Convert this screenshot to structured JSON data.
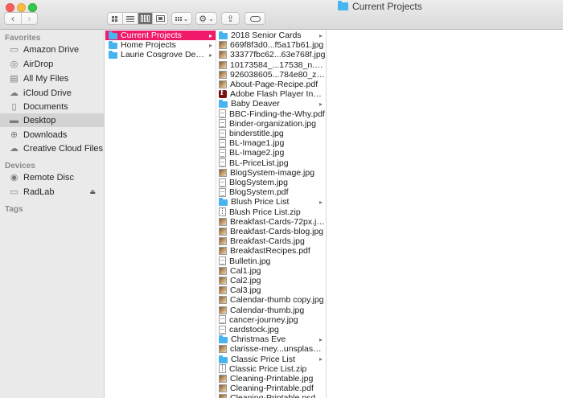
{
  "window": {
    "title": "Current Projects",
    "traffic_lights": {
      "close": "#fc605c",
      "minimize": "#fdbc40",
      "maximize": "#34c84a"
    }
  },
  "toolbar": {
    "back_glyph": "‹",
    "forward_glyph": "›",
    "action_glyph": "⚙",
    "share_glyph": "⇪",
    "dropdown_glyph": "⌄",
    "active_view": "column"
  },
  "sidebar": {
    "sections": [
      {
        "title": "Favorites"
      },
      {
        "title": "Devices"
      },
      {
        "title": "Tags"
      }
    ],
    "favorites": [
      {
        "label": "Amazon Drive",
        "icon": "amazon-drive-icon",
        "glyph": "▭"
      },
      {
        "label": "AirDrop",
        "icon": "airdrop-icon",
        "glyph": "◎"
      },
      {
        "label": "All My Files",
        "icon": "all-my-files-icon",
        "glyph": "▤"
      },
      {
        "label": "iCloud Drive",
        "icon": "icloud-icon",
        "glyph": "☁"
      },
      {
        "label": "Documents",
        "icon": "documents-icon",
        "glyph": "▯"
      },
      {
        "label": "Desktop",
        "icon": "desktop-icon",
        "glyph": "▬",
        "selected": true
      },
      {
        "label": "Downloads",
        "icon": "downloads-icon",
        "glyph": "⊕"
      },
      {
        "label": "Creative Cloud Files",
        "icon": "creative-cloud-icon",
        "glyph": "☁"
      }
    ],
    "devices": [
      {
        "label": "Remote Disc",
        "icon": "remote-disc-icon",
        "glyph": "◉"
      },
      {
        "label": "RadLab",
        "icon": "hard-drive-icon",
        "glyph": "▭",
        "eject": "⏏"
      }
    ]
  },
  "column1": {
    "items": [
      {
        "label": "Current Projects",
        "type": "folder",
        "selected": true,
        "has_children": true
      },
      {
        "label": "Home Projects",
        "type": "folder",
        "has_children": true
      },
      {
        "label": "Laurie Cosgrove Design",
        "type": "folder",
        "has_children": true
      }
    ]
  },
  "column2": {
    "items": [
      {
        "label": "2018 Senior Cards",
        "type": "folder",
        "has_children": true
      },
      {
        "label": "669f8f3d0...f5a17b61.jpg",
        "type": "image"
      },
      {
        "label": "33377fbc62...63e768f.jpg",
        "type": "image"
      },
      {
        "label": "10173584_...17538_n.png",
        "type": "image"
      },
      {
        "label": "926038605...784e80_z.jpg",
        "type": "image"
      },
      {
        "label": "About-Page-Recipe.pdf",
        "type": "image"
      },
      {
        "label": "Adobe Flash Player Installer",
        "type": "app"
      },
      {
        "label": "Baby Deaver",
        "type": "folder",
        "has_children": true
      },
      {
        "label": "BBC-Finding-the-Why.pdf",
        "type": "doc"
      },
      {
        "label": "Binder-organization.jpg",
        "type": "doc"
      },
      {
        "label": "binderstitle.jpg",
        "type": "doc"
      },
      {
        "label": "BL-Image1.jpg",
        "type": "doc"
      },
      {
        "label": "BL-Image2.jpg",
        "type": "doc"
      },
      {
        "label": "BL-PriceList.jpg",
        "type": "doc"
      },
      {
        "label": "BlogSystem-image.jpg",
        "type": "image"
      },
      {
        "label": "BlogSystem.jpg",
        "type": "doc"
      },
      {
        "label": "BlogSystem.pdf",
        "type": "doc"
      },
      {
        "label": "Blush Price List",
        "type": "folder",
        "has_children": true
      },
      {
        "label": "Blush Price List.zip",
        "type": "zip"
      },
      {
        "label": "Breakfast-Cards-72px.jpg",
        "type": "image"
      },
      {
        "label": "Breakfast-Cards-blog.jpg",
        "type": "image"
      },
      {
        "label": "Breakfast-Cards.jpg",
        "type": "image"
      },
      {
        "label": "BreakfastRecipes.pdf",
        "type": "image"
      },
      {
        "label": "Bulletin.jpg",
        "type": "doc"
      },
      {
        "label": "Cal1.jpg",
        "type": "image"
      },
      {
        "label": "Cal2.jpg",
        "type": "image"
      },
      {
        "label": "Cal3.jpg",
        "type": "image"
      },
      {
        "label": "Calendar-thumb copy.jpg",
        "type": "image"
      },
      {
        "label": "Calendar-thumb.jpg",
        "type": "image"
      },
      {
        "label": "cancer-journey.jpg",
        "type": "doc"
      },
      {
        "label": "cardstock.jpg",
        "type": "doc"
      },
      {
        "label": "Christmas Eve",
        "type": "folder",
        "has_children": true
      },
      {
        "label": "clarisse-mey...unsplash.jpg",
        "type": "image"
      },
      {
        "label": "Classic Price List",
        "type": "folder",
        "has_children": true
      },
      {
        "label": "Classic Price List.zip",
        "type": "zip"
      },
      {
        "label": "Cleaning-Printable.jpg",
        "type": "image"
      },
      {
        "label": "Cleaning-Printable.pdf",
        "type": "image"
      },
      {
        "label": "Cleaning-Printable.psd",
        "type": "image"
      }
    ]
  },
  "colors": {
    "selection": "#f01a6b",
    "folder": "#48b4ef",
    "sidebar_bg": "#eaeaea"
  }
}
